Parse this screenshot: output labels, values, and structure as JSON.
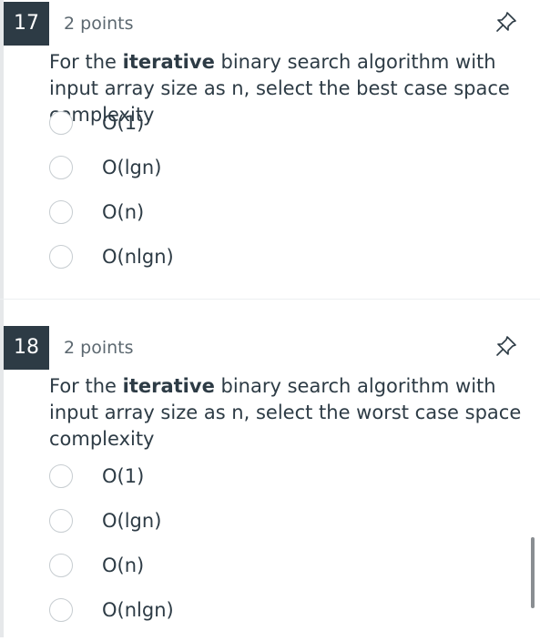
{
  "questions": [
    {
      "number": "17",
      "points": "2 points",
      "text_pre": "For the ",
      "text_bold": "iterative",
      "text_post": " binary search algorithm with input array size as n, select the best case space complexity",
      "answers": [
        "O(1)",
        "O(lgn)",
        "O(n)",
        "O(nlgn)"
      ]
    },
    {
      "number": "18",
      "points": "2 points",
      "text_pre": "For the ",
      "text_bold": "iterative",
      "text_post": " binary search algorithm with input array size as n, select the worst case space complexity",
      "answers": [
        "O(1)",
        "O(lgn)",
        "O(n)",
        "O(nlgn)"
      ]
    }
  ],
  "icons": {
    "pin": "pin-icon"
  },
  "colors": {
    "number_badge": "#2d3b45",
    "text": "#2d3b45",
    "muted": "#5c6870"
  }
}
